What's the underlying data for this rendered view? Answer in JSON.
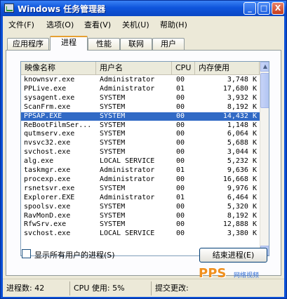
{
  "window": {
    "title": "Windows 任务管理器"
  },
  "title_buttons": {
    "minimize": "_",
    "maximize": "□",
    "close": "X"
  },
  "menu": [
    "文件(F)",
    "选项(O)",
    "查看(V)",
    "关机(U)",
    "帮助(H)"
  ],
  "tabs": [
    "应用程序",
    "进程",
    "性能",
    "联网",
    "用户"
  ],
  "active_tab": "进程",
  "columns": [
    "映像名称",
    "用户名",
    "CPU",
    "内存使用"
  ],
  "rows": [
    [
      "knownsvr.exe",
      "Administrator",
      "00",
      "3,748 K"
    ],
    [
      "PPLive.exe",
      "Administrator",
      "01",
      "17,680 K"
    ],
    [
      "sysagent.exe",
      "SYSTEM",
      "00",
      "3,932 K"
    ],
    [
      "ScanFrm.exe",
      "SYSTEM",
      "00",
      "8,192 K"
    ],
    [
      "PPSAP.EXE",
      "SYSTEM",
      "00",
      "14,432 K"
    ],
    [
      "ReBootFilmSer...",
      "SYSTEM",
      "00",
      "1,148 K"
    ],
    [
      "qutmserv.exe",
      "SYSTEM",
      "00",
      "6,064 K"
    ],
    [
      "nvsvc32.exe",
      "SYSTEM",
      "00",
      "5,688 K"
    ],
    [
      "svchost.exe",
      "SYSTEM",
      "00",
      "3,044 K"
    ],
    [
      "alg.exe",
      "LOCAL SERVICE",
      "00",
      "5,232 K"
    ],
    [
      "taskmgr.exe",
      "Administrator",
      "01",
      "9,636 K"
    ],
    [
      "procexp.exe",
      "Administrator",
      "00",
      "16,668 K"
    ],
    [
      "rsnetsvr.exe",
      "SYSTEM",
      "00",
      "9,976 K"
    ],
    [
      "Explorer.EXE",
      "Administrator",
      "01",
      "6,464 K"
    ],
    [
      "spoolsv.exe",
      "SYSTEM",
      "00",
      "5,320 K"
    ],
    [
      "RavMonD.exe",
      "SYSTEM",
      "00",
      "8,192 K"
    ],
    [
      "RfwSrv.exe",
      "SYSTEM",
      "00",
      "12,888 K"
    ],
    [
      "svchost.exe",
      "LOCAL SERVICE",
      "00",
      "3,380 K"
    ]
  ],
  "selected_row_index": 4,
  "show_all_users_label": "显示所有用户的进程(S)",
  "end_process_label": "结束进程(E)",
  "status": {
    "processes": "进程数: 42",
    "cpu": "CPU 使用: 5%",
    "commit": "提交更改:"
  },
  "watermark": {
    "logo": "PPS",
    "sub": "网络视频"
  },
  "colors": {
    "title_blue": "#0a4fd6",
    "selection": "#316ac5",
    "tab_accent": "#e6a031"
  }
}
